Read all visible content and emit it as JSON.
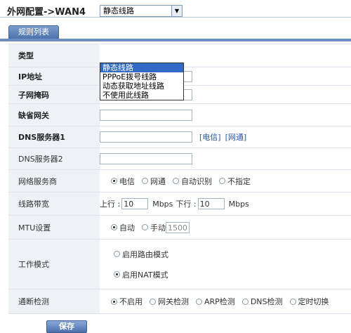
{
  "page": {
    "title": "外网配置->WAN4",
    "tab": "规则列表",
    "save_label": "保存"
  },
  "form": {
    "line_type": {
      "label": "类型",
      "value": "静态线路",
      "options": [
        "静态线路",
        "PPPoE拨号线路",
        "动态获取地址线路",
        "不使用此线路"
      ]
    },
    "ip": {
      "label": "IP地址",
      "value": ""
    },
    "mask": {
      "label": "子网掩码",
      "value": ""
    },
    "gateway": {
      "label": "缺省网关",
      "value": ""
    },
    "dns1": {
      "label": "DNS服务器1",
      "value": "",
      "links": [
        "[电信]",
        "[网通]"
      ]
    },
    "dns2": {
      "label": "DNS服务器2",
      "value": ""
    },
    "isp": {
      "label": "网络服务商",
      "options": [
        "电信",
        "网通",
        "自动识别",
        "不指定"
      ],
      "selected": 0
    },
    "bandwidth": {
      "label": "线路带宽",
      "up_label": "上行 :",
      "up_value": "10",
      "unit": "Mbps",
      "down_label": "下行 :",
      "down_value": "10"
    },
    "mtu": {
      "label": "MTU设置",
      "options": [
        "自动",
        "手动"
      ],
      "selected": 0,
      "manual_value": "1500"
    },
    "work_mode": {
      "label": "工作模式",
      "options": [
        "启用路由模式",
        "启用NAT模式"
      ],
      "selected": 1
    },
    "detect": {
      "label": "通断检测",
      "options": [
        "不启用",
        "网关检测",
        "ARP检测",
        "DNS检测",
        "定时切换"
      ],
      "selected": 0
    }
  }
}
